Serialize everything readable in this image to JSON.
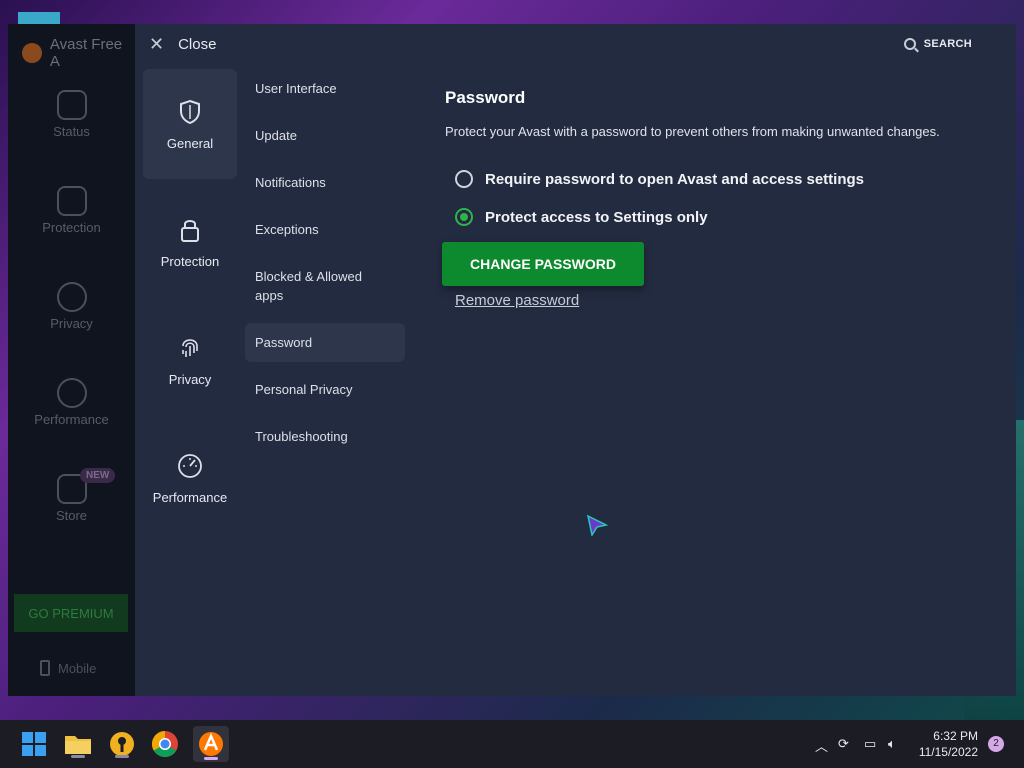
{
  "app": {
    "title": "Avast Free A",
    "sidebar": [
      {
        "label": "Status",
        "icon": "shield-icon"
      },
      {
        "label": "Protection",
        "icon": "lock-icon"
      },
      {
        "label": "Privacy",
        "icon": "fingerprint-icon"
      },
      {
        "label": "Performance",
        "icon": "speedometer-icon"
      },
      {
        "label": "Store",
        "icon": "cart-icon",
        "badge": "NEW"
      }
    ],
    "go_premium": "GO PREMIUM",
    "mobile": "Mobile"
  },
  "settings": {
    "close_label": "Close",
    "search_label": "SEARCH",
    "categories": [
      {
        "label": "General",
        "icon": "shield-icon",
        "active": true
      },
      {
        "label": "Protection",
        "icon": "lock-icon",
        "active": false
      },
      {
        "label": "Privacy",
        "icon": "fingerprint-icon",
        "active": false
      },
      {
        "label": "Performance",
        "icon": "speedometer-icon",
        "active": false
      }
    ],
    "subitems": [
      "User Interface",
      "Update",
      "Notifications",
      "Exceptions",
      "Blocked & Allowed apps",
      "Password",
      "Personal Privacy",
      "Troubleshooting"
    ],
    "active_subitem": "Password",
    "content": {
      "title": "Password",
      "description": "Protect your Avast with a password to prevent others from making unwanted changes.",
      "options": [
        {
          "label": "Require password to open Avast and access settings",
          "checked": false
        },
        {
          "label": "Protect access to Settings only",
          "checked": true
        }
      ],
      "change_button": "CHANGE PASSWORD",
      "remove_link": "Remove password"
    }
  },
  "taskbar": {
    "time": "6:32 PM",
    "date": "11/15/2022",
    "notification_count": "2"
  },
  "colors": {
    "accent_green": "#0e8a2e",
    "radio_green": "#2fb34a",
    "panel_bg": "#232b40"
  }
}
